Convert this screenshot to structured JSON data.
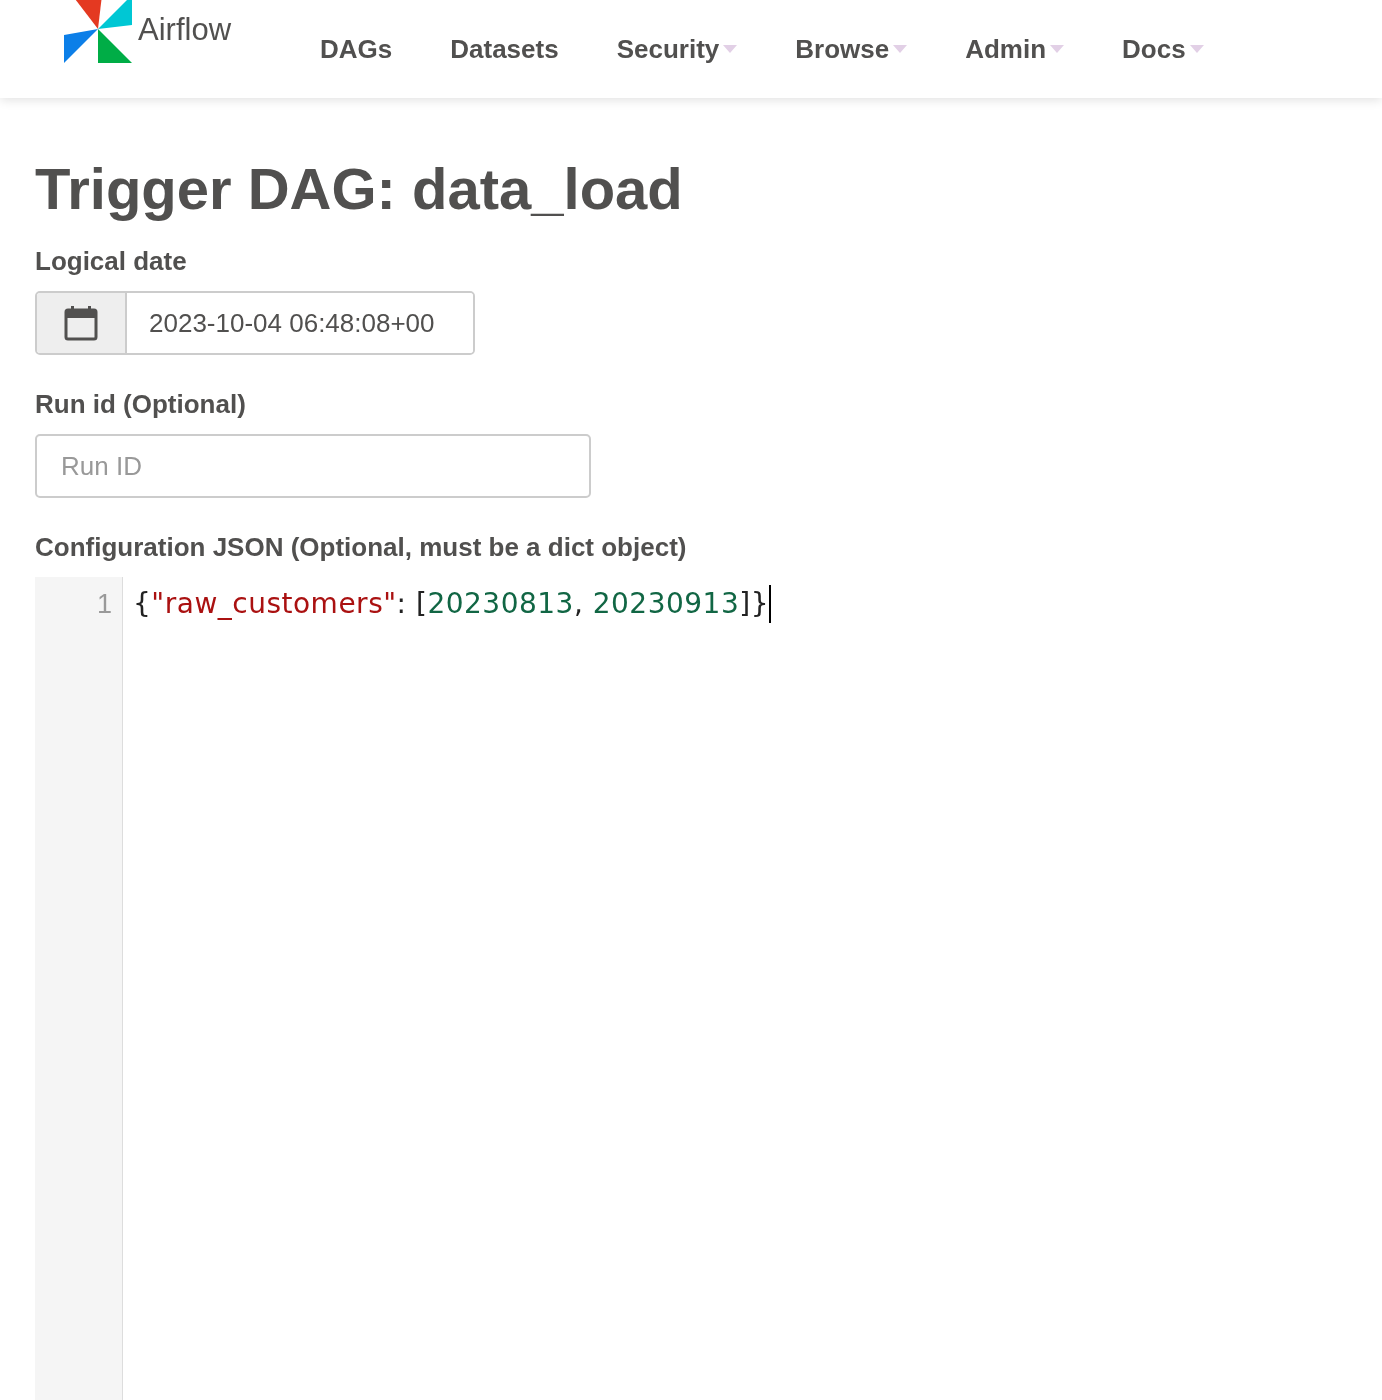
{
  "brand": {
    "name": "Airflow"
  },
  "nav": [
    {
      "label": "DAGs",
      "dropdown": false
    },
    {
      "label": "Datasets",
      "dropdown": false
    },
    {
      "label": "Security",
      "dropdown": true
    },
    {
      "label": "Browse",
      "dropdown": true
    },
    {
      "label": "Admin",
      "dropdown": true
    },
    {
      "label": "Docs",
      "dropdown": true
    }
  ],
  "title": "Trigger DAG: data_load",
  "logical_date": {
    "label": "Logical date",
    "value": "2023-10-04 06:48:08+00"
  },
  "run_id": {
    "label": "Run id (Optional)",
    "placeholder": "Run ID"
  },
  "config": {
    "label": "Configuration JSON (Optional, must be a dict object)",
    "lines": [
      {
        "number": "1",
        "tokens": [
          {
            "kind": "punct",
            "text": "{"
          },
          {
            "kind": "string",
            "text": "\"raw_customers\""
          },
          {
            "kind": "punct",
            "text": ": ["
          },
          {
            "kind": "number",
            "text": "20230813"
          },
          {
            "kind": "punct",
            "text": ", "
          },
          {
            "kind": "number",
            "text": "20230913"
          },
          {
            "kind": "punct",
            "text": "]}"
          }
        ]
      }
    ]
  }
}
